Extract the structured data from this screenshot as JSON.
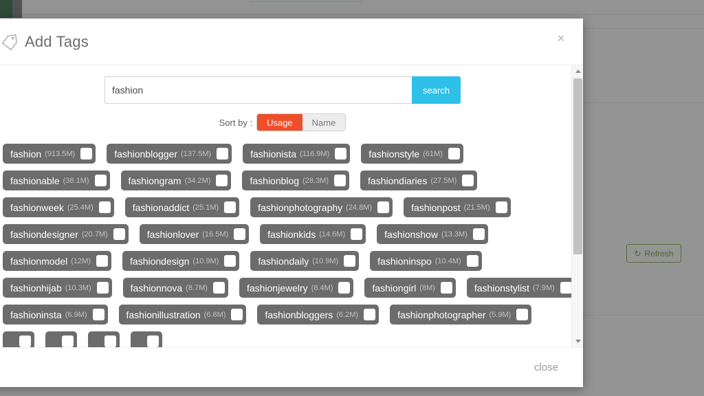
{
  "background": {
    "refresh_button": {
      "label": "Refresh",
      "icon": "refresh-icon",
      "glyph": "↻",
      "border_color": "#7ba428",
      "text_color": "#6f9423"
    },
    "sidebar_color": "#1d5c33"
  },
  "modal": {
    "title": "Add Tags",
    "title_icon": "tag-icon",
    "close_x": "×",
    "search": {
      "value": "fashion",
      "placeholder": "",
      "button_label": "search",
      "button_color": "#2ec0e8"
    },
    "sort": {
      "label": "Sort by :",
      "options": [
        {
          "label": "Usage",
          "active": true
        },
        {
          "label": "Name",
          "active": false
        }
      ],
      "active_color": "#ef4e2a"
    },
    "tag_rows": [
      [
        {
          "name": "fashion",
          "count": "(913.5M)",
          "checked": false
        },
        {
          "name": "fashionblogger",
          "count": "(137.5M)",
          "checked": false
        },
        {
          "name": "fashionista",
          "count": "(116.9M)",
          "checked": false
        },
        {
          "name": "fashionstyle",
          "count": "(61M)",
          "checked": false
        }
      ],
      [
        {
          "name": "fashionable",
          "count": "(38.1M)",
          "checked": false
        },
        {
          "name": "fashiongram",
          "count": "(34.2M)",
          "checked": false
        },
        {
          "name": "fashionblog",
          "count": "(28.3M)",
          "checked": false
        },
        {
          "name": "fashiondiaries",
          "count": "(27.5M)",
          "checked": false
        }
      ],
      [
        {
          "name": "fashionweek",
          "count": "(25.4M)",
          "checked": false
        },
        {
          "name": "fashionaddict",
          "count": "(25.1M)",
          "checked": false
        },
        {
          "name": "fashionphotography",
          "count": "(24.8M)",
          "checked": false
        },
        {
          "name": "fashionpost",
          "count": "(21.5M)",
          "checked": false
        }
      ],
      [
        {
          "name": "fashiondesigner",
          "count": "(20.7M)",
          "checked": false
        },
        {
          "name": "fashionlover",
          "count": "(16.5M)",
          "checked": false
        },
        {
          "name": "fashionkids",
          "count": "(14.6M)",
          "checked": false
        },
        {
          "name": "fashionshow",
          "count": "(13.3M)",
          "checked": false
        }
      ],
      [
        {
          "name": "fashionmodel",
          "count": "(12M)",
          "checked": false
        },
        {
          "name": "fashiondesign",
          "count": "(10.9M)",
          "checked": false
        },
        {
          "name": "fashiondaily",
          "count": "(10.9M)",
          "checked": false
        },
        {
          "name": "fashioninspo",
          "count": "(10.4M)",
          "checked": false
        }
      ],
      [
        {
          "name": "fashionhijab",
          "count": "(10.3M)",
          "checked": false
        },
        {
          "name": "fashionnova",
          "count": "(8.7M)",
          "checked": false
        },
        {
          "name": "fashionjewelry",
          "count": "(8.4M)",
          "checked": false
        },
        {
          "name": "fashiongirl",
          "count": "(8M)",
          "checked": false
        },
        {
          "name": "fashionstylist",
          "count": "(7.9M)",
          "checked": false
        }
      ],
      [
        {
          "name": "fashioninsta",
          "count": "(6.9M)",
          "checked": false
        },
        {
          "name": "fashionillustration",
          "count": "(6.6M)",
          "checked": false
        },
        {
          "name": "fashionbloggers",
          "count": "(6.2M)",
          "checked": false
        },
        {
          "name": "fashionphotographer",
          "count": "(5.9M)",
          "checked": false
        }
      ],
      [
        {
          "name": "",
          "count": "",
          "checked": false
        },
        {
          "name": "",
          "count": "",
          "checked": false
        },
        {
          "name": "",
          "count": "",
          "checked": false
        },
        {
          "name": "",
          "count": "",
          "checked": false
        }
      ]
    ],
    "footer": {
      "close_label": "close"
    }
  }
}
